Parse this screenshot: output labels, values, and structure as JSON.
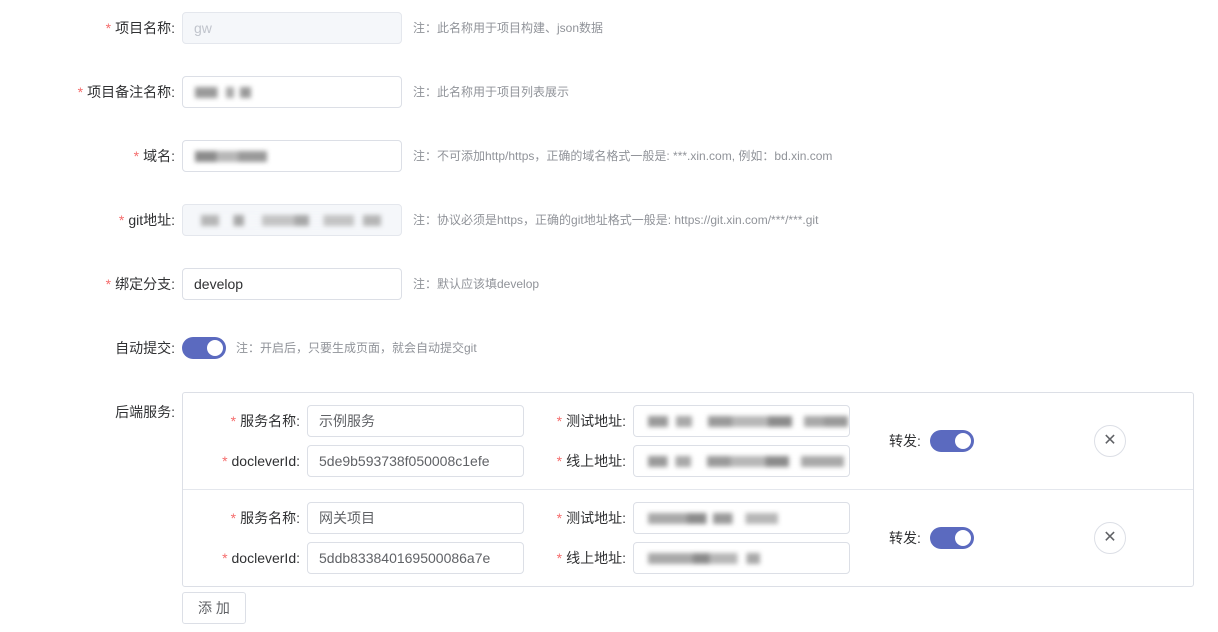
{
  "form": {
    "project_name": {
      "label": "项目名称:",
      "value": "gw",
      "note": "注：此名称用于项目构建、json数据"
    },
    "project_alias": {
      "label": "项目备注名称:",
      "value": "",
      "note": "注：此名称用于项目列表展示"
    },
    "domain": {
      "label": "域名:",
      "value": "",
      "note": "注：不可添加http/https，正确的域名格式一般是: ***.xin.com, 例如：bd.xin.com"
    },
    "git_address": {
      "label": "git地址:",
      "value": "",
      "note": "注：协议必须是https，正确的git地址格式一般是: https://git.xin.com/***/***.git"
    },
    "branch": {
      "label": "绑定分支:",
      "value": "develop",
      "note": "注：默认应该填develop"
    },
    "auto_commit": {
      "label": "自动提交:",
      "enabled": true,
      "note": "注：开启后，只要生成页面，就会自动提交git"
    },
    "backend_services_label": "后端服务:"
  },
  "services": [
    {
      "name_label": "服务名称:",
      "name_value": "示例服务",
      "docleverid_label": "docleverId:",
      "docleverid_value": "5de9b593738f050008c1efe",
      "test_label": "测试地址:",
      "online_label": "线上地址:",
      "forward_label": "转发:",
      "forward_enabled": true
    },
    {
      "name_label": "服务名称:",
      "name_value": "网关项目",
      "docleverid_label": "docleverId:",
      "docleverid_value": "5ddb833840169500086a7e",
      "test_label": "测试地址:",
      "online_label": "线上地址:",
      "forward_label": "转发:",
      "forward_enabled": true
    }
  ],
  "add_button": "添 加",
  "icons": {
    "close": "close-icon"
  },
  "colors": {
    "accent": "#5b6abf",
    "required": "#f56c6c"
  }
}
